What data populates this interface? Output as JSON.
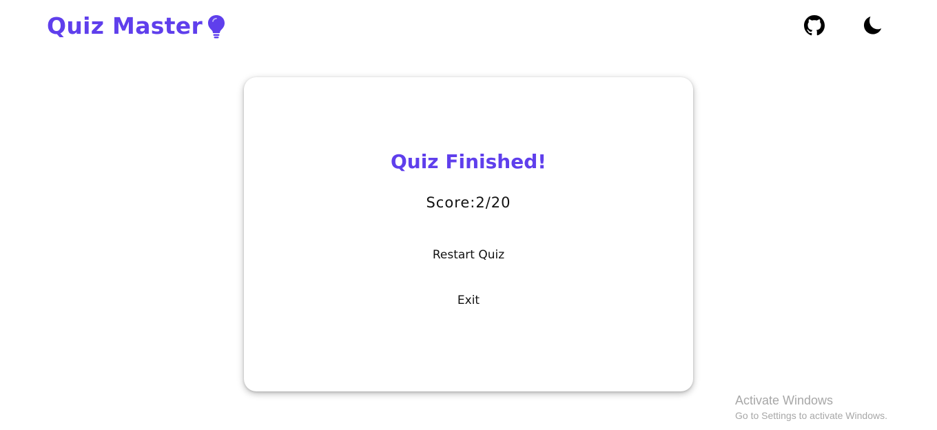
{
  "header": {
    "logo_text": "Quiz Master",
    "logo_icon": "lightbulb-icon",
    "github_icon": "github-icon",
    "theme_icon": "moon-icon"
  },
  "result": {
    "title": "Quiz Finished!",
    "score_text": "Score:2/20",
    "restart_label": "Restart Quiz",
    "exit_label": "Exit"
  },
  "watermark": {
    "line1": "Activate Windows",
    "line2": "Go to Settings to activate Windows."
  },
  "colors": {
    "accent": "#5f3fec",
    "text": "#111111",
    "background": "#ffffff",
    "watermark": "#a7a7a7"
  }
}
